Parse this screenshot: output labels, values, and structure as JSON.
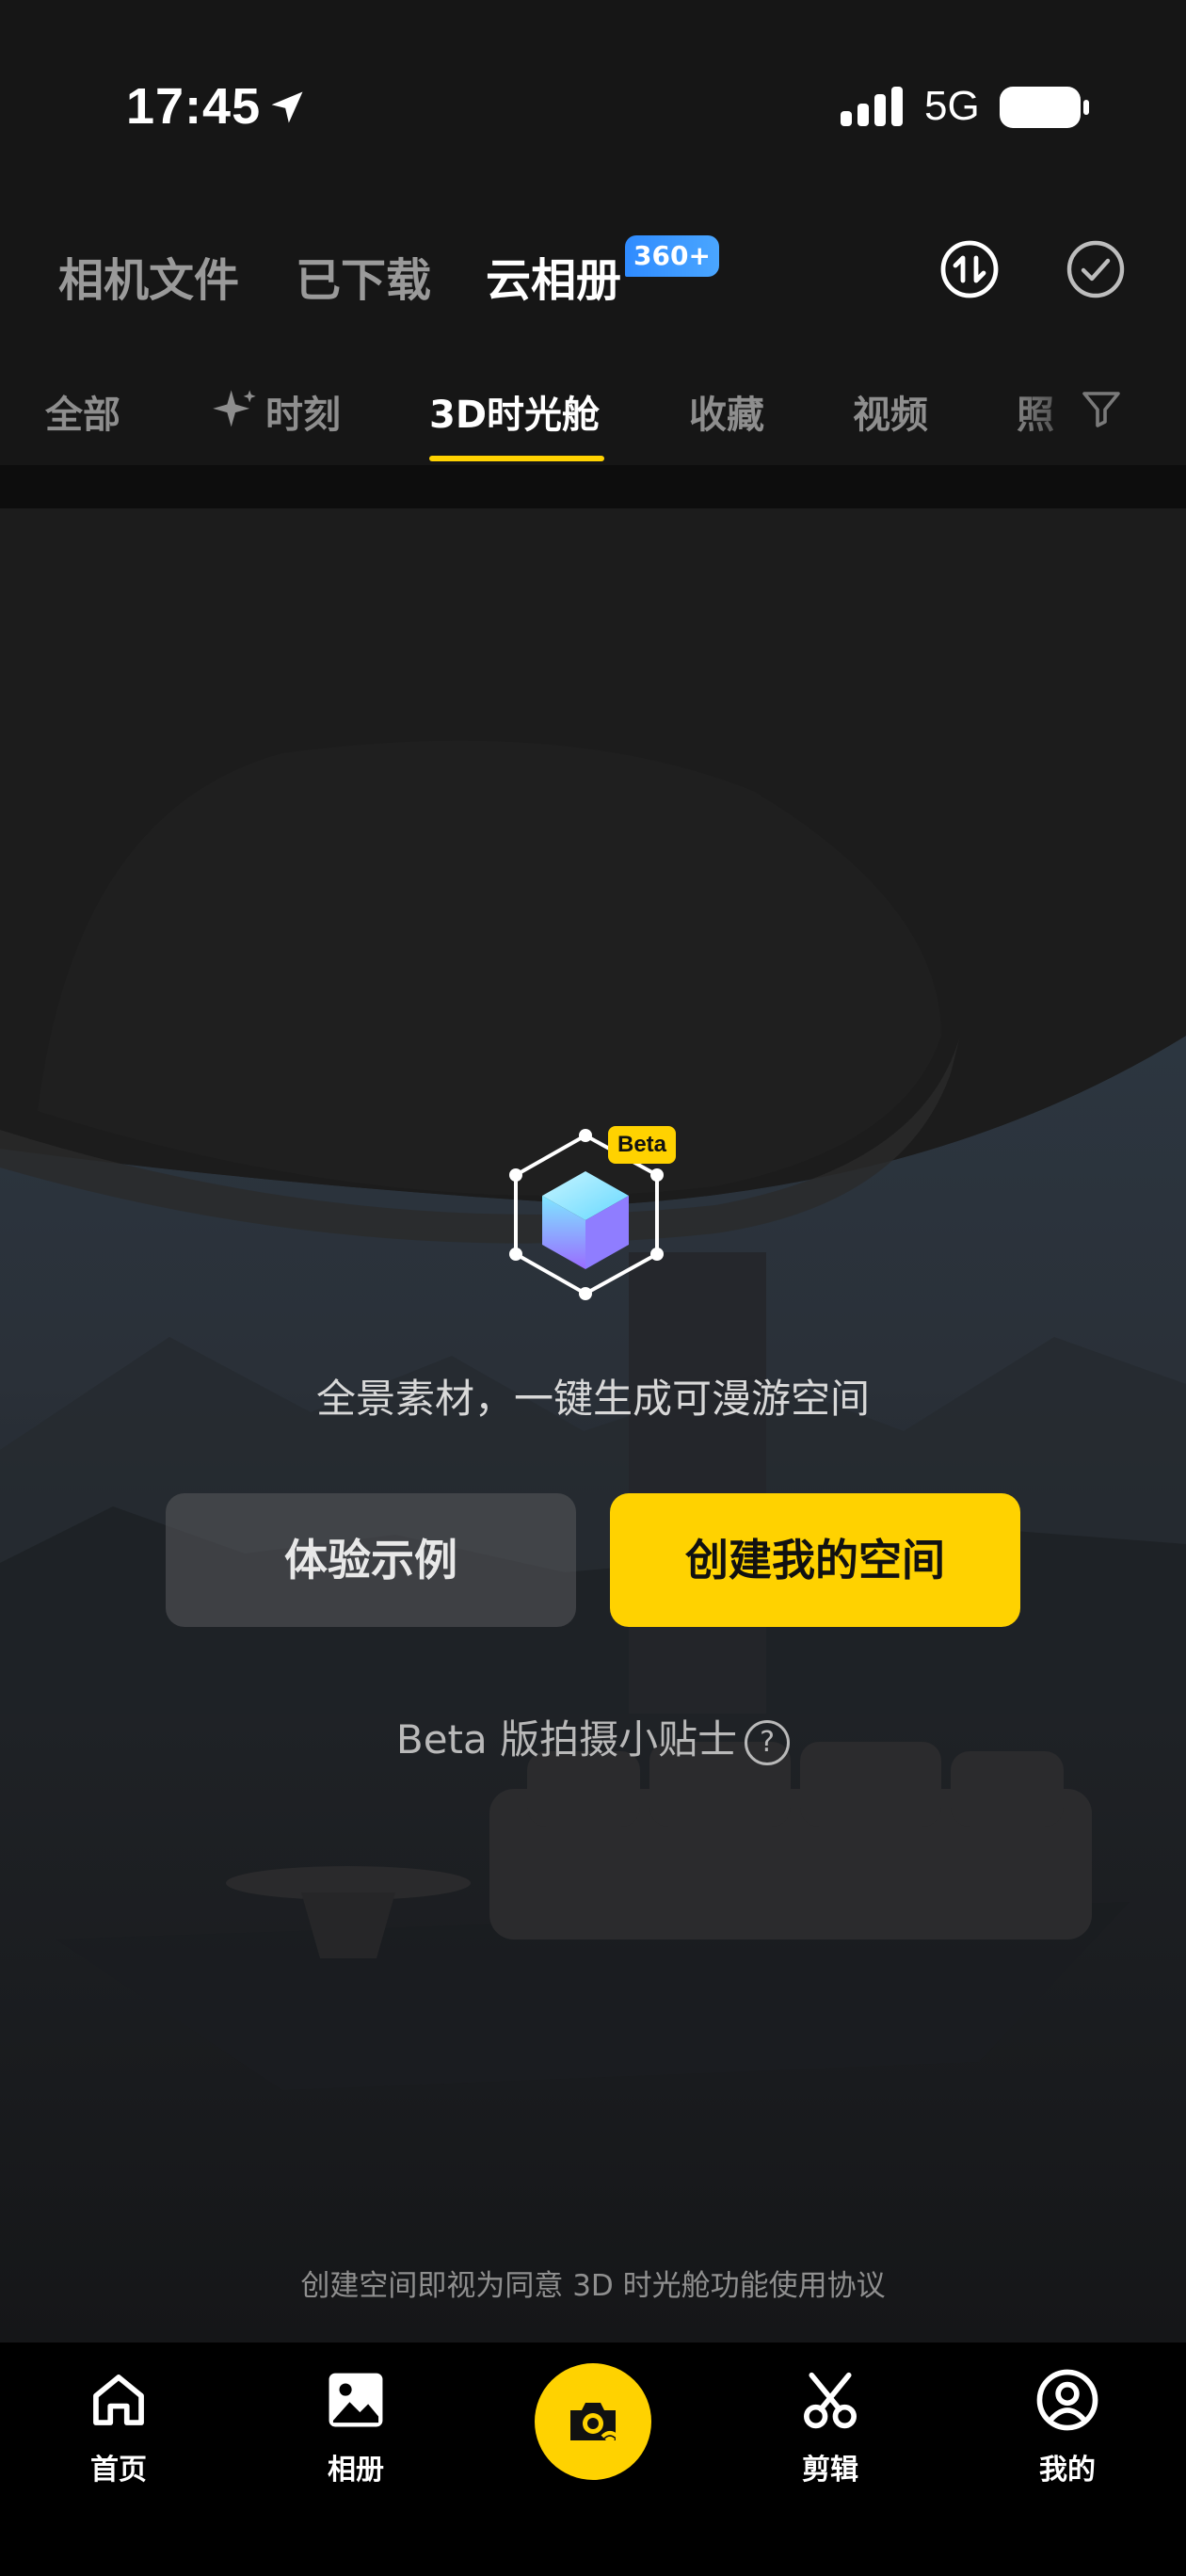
{
  "status_bar": {
    "time": "17:45",
    "network": "5G"
  },
  "top_tabs": [
    {
      "label": "相机文件",
      "active": false
    },
    {
      "label": "已下载",
      "active": false
    },
    {
      "label": "云相册",
      "active": true,
      "badge": "360+"
    }
  ],
  "category_tabs": [
    {
      "label": "全部",
      "active": false
    },
    {
      "label": "时刻",
      "active": false,
      "icon": "sparkle-icon"
    },
    {
      "label": "3D时光舱",
      "active": true
    },
    {
      "label": "收藏",
      "active": false
    },
    {
      "label": "视频",
      "active": false
    },
    {
      "label": "照",
      "active": false
    }
  ],
  "main": {
    "beta_badge": "Beta",
    "description": "全景素材，一键生成可漫游空间",
    "demo_button": "体验示例",
    "create_button": "创建我的空间",
    "tips": "Beta 版拍摄小贴士",
    "tips_icon": "?",
    "agreement": "创建空间即视为同意 3D 时光舱功能使用协议"
  },
  "bottom_nav": [
    {
      "label": "首页",
      "icon": "home-icon"
    },
    {
      "label": "相册",
      "icon": "album-icon"
    },
    {
      "label": "",
      "icon": "camera-wifi-icon"
    },
    {
      "label": "剪辑",
      "icon": "scissors-icon"
    },
    {
      "label": "我的",
      "icon": "profile-icon"
    }
  ],
  "colors": {
    "accent": "#ffd200",
    "badge_blue": "#3a96ff",
    "background": "#161616"
  }
}
